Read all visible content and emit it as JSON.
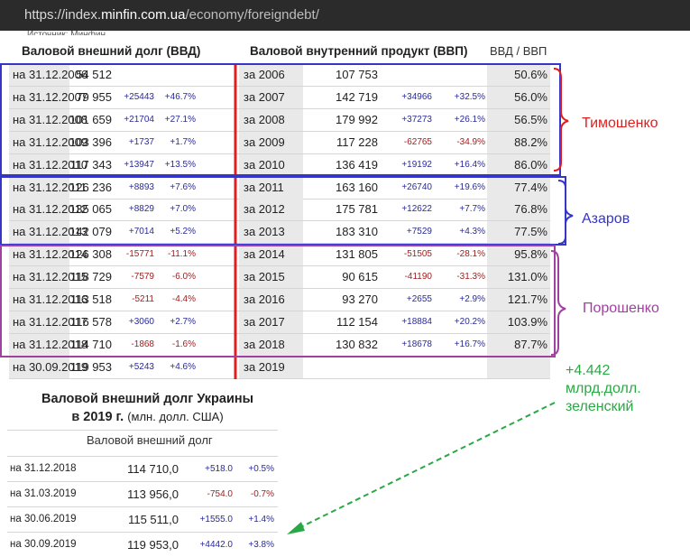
{
  "browser": {
    "url_prefix": "https://index.",
    "url_domain": "minfin.com.ua",
    "url_path": "/economy/foreigndebt/"
  },
  "clipped_text": "Источник: Минфин",
  "headers": {
    "debt": "Валовой внешний долг (ВВД)",
    "gdp": "Валовой внутренний продукт (ВВП)",
    "ratio": "ВВД / ВВП"
  },
  "rows": [
    {
      "date": "на 31.12.2006",
      "debt": "54 512",
      "debt_abs": "",
      "debt_pct": "",
      "year": "за 2006",
      "gdp": "107 753",
      "gdp_abs": "",
      "gdp_pct": "",
      "ratio": "50.6%"
    },
    {
      "date": "на 31.12.2007",
      "debt": "79 955",
      "debt_abs": "+25443",
      "debt_pct": "+46.7%",
      "year": "за 2007",
      "gdp": "142 719",
      "gdp_abs": "+34966",
      "gdp_pct": "+32.5%",
      "ratio": "56.0%"
    },
    {
      "date": "на 31.12.2008",
      "debt": "101 659",
      "debt_abs": "+21704",
      "debt_pct": "+27.1%",
      "year": "за 2008",
      "gdp": "179 992",
      "gdp_abs": "+37273",
      "gdp_pct": "+26.1%",
      "ratio": "56.5%"
    },
    {
      "date": "на 31.12.2009",
      "debt": "103 396",
      "debt_abs": "+1737",
      "debt_pct": "+1.7%",
      "year": "за 2009",
      "gdp": "117 228",
      "gdp_abs": "-62765",
      "gdp_pct": "-34.9%",
      "ratio": "88.2%"
    },
    {
      "date": "на 31.12.2010",
      "debt": "117 343",
      "debt_abs": "+13947",
      "debt_pct": "+13.5%",
      "year": "за 2010",
      "gdp": "136 419",
      "gdp_abs": "+19192",
      "gdp_pct": "+16.4%",
      "ratio": "86.0%"
    },
    {
      "date": "на 31.12.2011",
      "debt": "126 236",
      "debt_abs": "+8893",
      "debt_pct": "+7.6%",
      "year": "за 2011",
      "gdp": "163 160",
      "gdp_abs": "+26740",
      "gdp_pct": "+19.6%",
      "ratio": "77.4%"
    },
    {
      "date": "на 31.12.2012",
      "debt": "135 065",
      "debt_abs": "+8829",
      "debt_pct": "+7.0%",
      "year": "за 2012",
      "gdp": "175 781",
      "gdp_abs": "+12622",
      "gdp_pct": "+7.7%",
      "ratio": "76.8%"
    },
    {
      "date": "на 31.12.2013",
      "debt": "142 079",
      "debt_abs": "+7014",
      "debt_pct": "+5.2%",
      "year": "за 2013",
      "gdp": "183 310",
      "gdp_abs": "+7529",
      "gdp_pct": "+4.3%",
      "ratio": "77.5%"
    },
    {
      "date": "на 31.12.2014",
      "debt": "126 308",
      "debt_abs": "-15771",
      "debt_pct": "-11.1%",
      "year": "за 2014",
      "gdp": "131 805",
      "gdp_abs": "-51505",
      "gdp_pct": "-28.1%",
      "ratio": "95.8%"
    },
    {
      "date": "на 31.12.2015",
      "debt": "118 729",
      "debt_abs": "-7579",
      "debt_pct": "-6.0%",
      "year": "за 2015",
      "gdp": "90 615",
      "gdp_abs": "-41190",
      "gdp_pct": "-31.3%",
      "ratio": "131.0%"
    },
    {
      "date": "на 31.12.2016",
      "debt": "113 518",
      "debt_abs": "-5211",
      "debt_pct": "-4.4%",
      "year": "за 2016",
      "gdp": "93 270",
      "gdp_abs": "+2655",
      "gdp_pct": "+2.9%",
      "ratio": "121.7%"
    },
    {
      "date": "на 31.12.2017",
      "debt": "116 578",
      "debt_abs": "+3060",
      "debt_pct": "+2.7%",
      "year": "за 2017",
      "gdp": "112 154",
      "gdp_abs": "+18884",
      "gdp_pct": "+20.2%",
      "ratio": "103.9%"
    },
    {
      "date": "на 31.12.2018",
      "debt": "114 710",
      "debt_abs": "-1868",
      "debt_pct": "-1.6%",
      "year": "за 2018",
      "gdp": "130 832",
      "gdp_abs": "+18678",
      "gdp_pct": "+16.7%",
      "ratio": "87.7%"
    },
    {
      "date": "на 30.09.2019",
      "debt": "119 953",
      "debt_abs": "+5243",
      "debt_pct": "+4.6%",
      "year": "за 2019",
      "gdp": "",
      "gdp_abs": "",
      "gdp_pct": "",
      "ratio": ""
    }
  ],
  "bottom": {
    "title_line1": "Валовой внешний долг Украины",
    "title_line2": "в 2019 г.",
    "unit": "(млн. долл. США)",
    "column_header": "Валовой внешний долг",
    "rows": [
      {
        "date": "на 31.12.2018",
        "value": "114 710,0",
        "abs": "+518.0",
        "pct": "+0.5%"
      },
      {
        "date": "на 31.03.2019",
        "value": "113 956,0",
        "abs": "-754.0",
        "pct": "-0.7%"
      },
      {
        "date": "на 30.06.2019",
        "value": "115 511,0",
        "abs": "+1555.0",
        "pct": "+1.4%"
      },
      {
        "date": "на 30.09.2019",
        "value": "119 953,0",
        "abs": "+4442.0",
        "pct": "+3.8%"
      }
    ]
  },
  "annotations": {
    "tymoshenko": "Тимошенко",
    "azarov": "Азаров",
    "poroshenko": "Порошенко",
    "zelensky_line1": "+4.442",
    "zelensky_line2": "млрд.долл.",
    "zelensky_line3": "зеленский"
  },
  "colors": {
    "red": "#e11d1d",
    "blue": "#3535c8",
    "purple": "#a040a0",
    "green": "#2aa845",
    "positive": "#2a2a9a",
    "negative": "#a02020"
  }
}
